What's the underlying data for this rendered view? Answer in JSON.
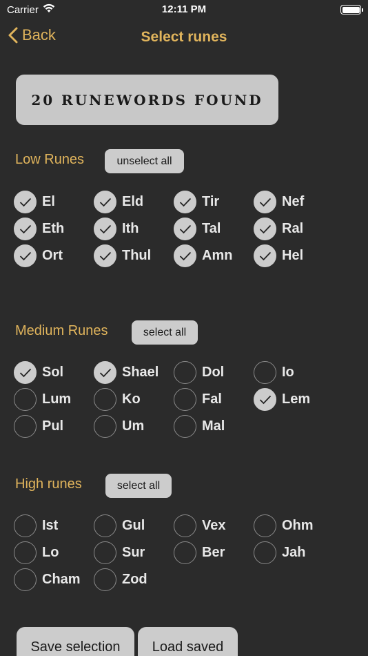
{
  "status": {
    "carrier": "Carrier",
    "time": "12:11 PM"
  },
  "nav": {
    "back_label": "Back",
    "title": "Select runes"
  },
  "banner": {
    "text": "20 RUNEWORDS FOUND"
  },
  "sections": {
    "low": {
      "title": "Low Runes",
      "button_label": "unselect all",
      "runes": [
        {
          "name": "El",
          "selected": true
        },
        {
          "name": "Eld",
          "selected": true
        },
        {
          "name": "Tir",
          "selected": true
        },
        {
          "name": "Nef",
          "selected": true
        },
        {
          "name": "Eth",
          "selected": true
        },
        {
          "name": "Ith",
          "selected": true
        },
        {
          "name": "Tal",
          "selected": true
        },
        {
          "name": "Ral",
          "selected": true
        },
        {
          "name": "Ort",
          "selected": true
        },
        {
          "name": "Thul",
          "selected": true
        },
        {
          "name": "Amn",
          "selected": true
        },
        {
          "name": "Hel",
          "selected": true
        }
      ]
    },
    "medium": {
      "title": "Medium Runes",
      "button_label": "select all",
      "runes": [
        {
          "name": "Sol",
          "selected": true
        },
        {
          "name": "Shael",
          "selected": true
        },
        {
          "name": "Dol",
          "selected": false
        },
        {
          "name": "Io",
          "selected": false
        },
        {
          "name": "Lum",
          "selected": false
        },
        {
          "name": "Ko",
          "selected": false
        },
        {
          "name": "Fal",
          "selected": false
        },
        {
          "name": "Lem",
          "selected": true
        },
        {
          "name": "Pul",
          "selected": false
        },
        {
          "name": "Um",
          "selected": false
        },
        {
          "name": "Mal",
          "selected": false
        }
      ]
    },
    "high": {
      "title": "High runes",
      "button_label": "select all",
      "runes": [
        {
          "name": "Ist",
          "selected": false
        },
        {
          "name": "Gul",
          "selected": false
        },
        {
          "name": "Vex",
          "selected": false
        },
        {
          "name": "Ohm",
          "selected": false
        },
        {
          "name": "Lo",
          "selected": false
        },
        {
          "name": "Sur",
          "selected": false
        },
        {
          "name": "Ber",
          "selected": false
        },
        {
          "name": "Jah",
          "selected": false
        },
        {
          "name": "Cham",
          "selected": false
        },
        {
          "name": "Zod",
          "selected": false
        }
      ]
    }
  },
  "footer": {
    "save_label": "Save selection",
    "load_label": "Load saved"
  },
  "colors": {
    "background": "#2b2b2b",
    "accent": "#e0b45c",
    "button": "#cccccc"
  }
}
